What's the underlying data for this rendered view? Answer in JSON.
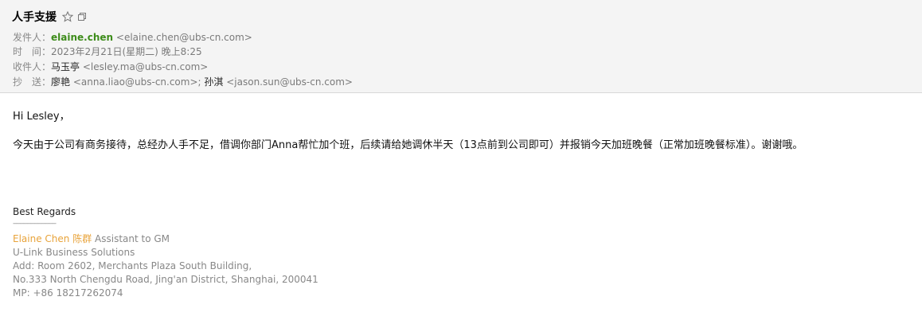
{
  "email": {
    "subject": "人手支援",
    "from_label": "发件人：",
    "from_name": "elaine.chen",
    "from_address": "<elaine.chen@ubs-cn.com>",
    "date_label": "时　间：",
    "date_value": "2023年2月21日(星期二) 晚上8:25",
    "to_label": "收件人：",
    "to_name": "马玉亭",
    "to_address": "<lesley.ma@ubs-cn.com>",
    "cc_label": "抄　送：",
    "cc_1_name": "廖艳",
    "cc_1_address": "<anna.liao@ubs-cn.com>;",
    "cc_2_name": "孙淇",
    "cc_2_address": "<jason.sun@ubs-cn.com>"
  },
  "body": {
    "greeting": "Hi Lesley，",
    "paragraph": "今天由于公司有商务接待，总经办人手不足，借调你部门Anna帮忙加个班，后续请给她调休半天（13点前到公司即可）并报销今天加班晚餐（正常加班晚餐标准）。谢谢哦。"
  },
  "signature": {
    "regards": "Best Regards",
    "separator": "------------------------",
    "name": "Elaine Chen 陈群",
    "title": "Assistant to GM",
    "company": "U-Link Business Solutions",
    "address_line1": "Add: Room 2602, Merchants Plaza South Building,",
    "address_line2": "No.333 North Chengdu Road,  Jing'an District, Shanghai, 200041",
    "mobile": "MP: +86 18217262074"
  },
  "icons": {
    "star": "star-outline-icon",
    "popout": "popout-window-icon"
  },
  "colors": {
    "sender_name": "#3d8c1a",
    "signature_name": "#e8a33a",
    "header_bg": "#f4f4f4"
  }
}
